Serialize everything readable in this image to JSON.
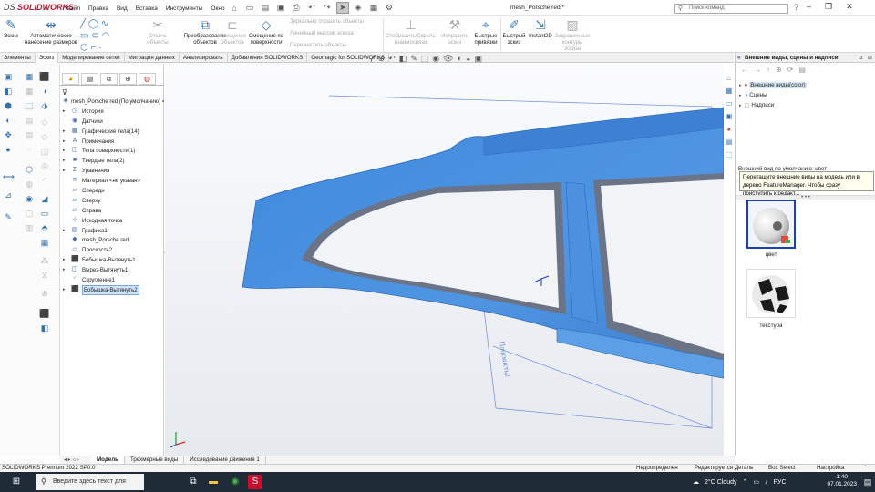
{
  "app": {
    "logo_brand": "SOLIDWORKS",
    "logo_prefix": "DS",
    "document_title": "mesh_Porsche red *",
    "search_placeholder": "Поиск команд"
  },
  "menu": [
    "Файл",
    "Правка",
    "Вид",
    "Вставка",
    "Инструменты",
    "Окно"
  ],
  "ribbon": {
    "sketch": "Эскиз",
    "auto_dim": "Автоматическое нанесение размеров",
    "trim": "Отсечь объекты",
    "convert": "Преобразование объектов",
    "offset": "Смещение объектов",
    "offset_surface": "Смещение по поверхности",
    "mirror": "Зеркально отразить объекты",
    "linear_pattern": "Линейный массив эскиза",
    "move": "Переместить объекты",
    "show_hide": "Отобразить/Скрыть взаимосвязи",
    "repair": "Исправить эскиз",
    "quick_snaps": "Быстрые привязки",
    "rapid_sketch": "Быстрый эскиз",
    "instant2d": "Instant2D",
    "shaded_contours": "Закрашенные контуры эскиза"
  },
  "tabs": [
    "Элементы",
    "Эскиз",
    "Моделирование сетки",
    "Миграция данных",
    "Анализировать",
    "Добавления SOLIDWORKS",
    "Geomagic for SOLIDWORKS"
  ],
  "active_tab": "Эскиз",
  "feature_tree": [
    {
      "label": "mesh_Porsche red  (По умолчанию) <<По",
      "icon": "part-icon",
      "root": true
    },
    {
      "label": "История",
      "icon": "history-icon",
      "expand": true
    },
    {
      "label": "Датчики",
      "icon": "sensor-icon"
    },
    {
      "label": "Графические тела(14)",
      "icon": "graphics-bodies-icon",
      "expand": true
    },
    {
      "label": "Примечания",
      "icon": "annotations-icon",
      "expand": true
    },
    {
      "label": "Тела поверхности(1)",
      "icon": "surface-bodies-icon",
      "expand": true
    },
    {
      "label": "Твердые тела(2)",
      "icon": "solid-bodies-icon",
      "expand": true
    },
    {
      "label": "Уравнения",
      "icon": "equations-icon",
      "expand": true
    },
    {
      "label": "Материал <не указан>",
      "icon": "material-icon"
    },
    {
      "label": "Спереди",
      "icon": "plane-icon"
    },
    {
      "label": "Сверху",
      "icon": "plane-icon"
    },
    {
      "label": "Справа",
      "icon": "plane-icon"
    },
    {
      "label": "Исходная точка",
      "icon": "origin-icon"
    },
    {
      "label": "Графика1",
      "icon": "graphics-icon",
      "expand": true
    },
    {
      "label": "mesh_Porsche red",
      "icon": "mesh-icon"
    },
    {
      "label": "Плоскость2",
      "icon": "plane-icon"
    },
    {
      "label": "Бобышка-Вытянуть1",
      "icon": "boss-extrude-icon",
      "expand": true
    },
    {
      "label": "Вырез-Вытянуть1",
      "icon": "cut-extrude-icon",
      "expand": true
    },
    {
      "label": "Скругление1",
      "icon": "fillet-icon"
    },
    {
      "label": "Бобышка-Вытянуть2",
      "icon": "boss-extrude-icon",
      "expand": true,
      "selected": true
    }
  ],
  "viewport": {
    "plane_label": "Плоскость2"
  },
  "taskpane": {
    "title": "Внешние виды, сцены и надписи",
    "items": [
      {
        "label": "Внешние виды(color)",
        "selected": true
      },
      {
        "label": "Сцены"
      },
      {
        "label": "Надписи"
      }
    ],
    "hint_label": "Внешний вид по умолчанию: цвет",
    "hint_text": "Перетащите внешние виды на модель или в дерево FeatureManager. Чтобы сразу приступить к редакт...",
    "thumbs": [
      {
        "label": "цвет",
        "selected": true
      },
      {
        "label": "текстура"
      }
    ]
  },
  "bottom_tabs": [
    "Модель",
    "Трехмерные виды",
    "Исследование движения 1"
  ],
  "status": {
    "product": "SOLIDWORKS Premium 2022 SP0.0",
    "defined": "Недоопределен",
    "editing": "Редактируется Деталь",
    "box_select": "Box Select",
    "settings": "Настройка"
  },
  "taskbar": {
    "search_placeholder": "Введите здесь текст для поиска",
    "weather": "2°C  Cloudy",
    "lang": "РУС",
    "time": "1:40",
    "date": "07.01.2023"
  },
  "colors": {
    "mesh_blue": "#4a8fdd",
    "accent": "#c8102e",
    "taskbar": "#1f2b36"
  }
}
